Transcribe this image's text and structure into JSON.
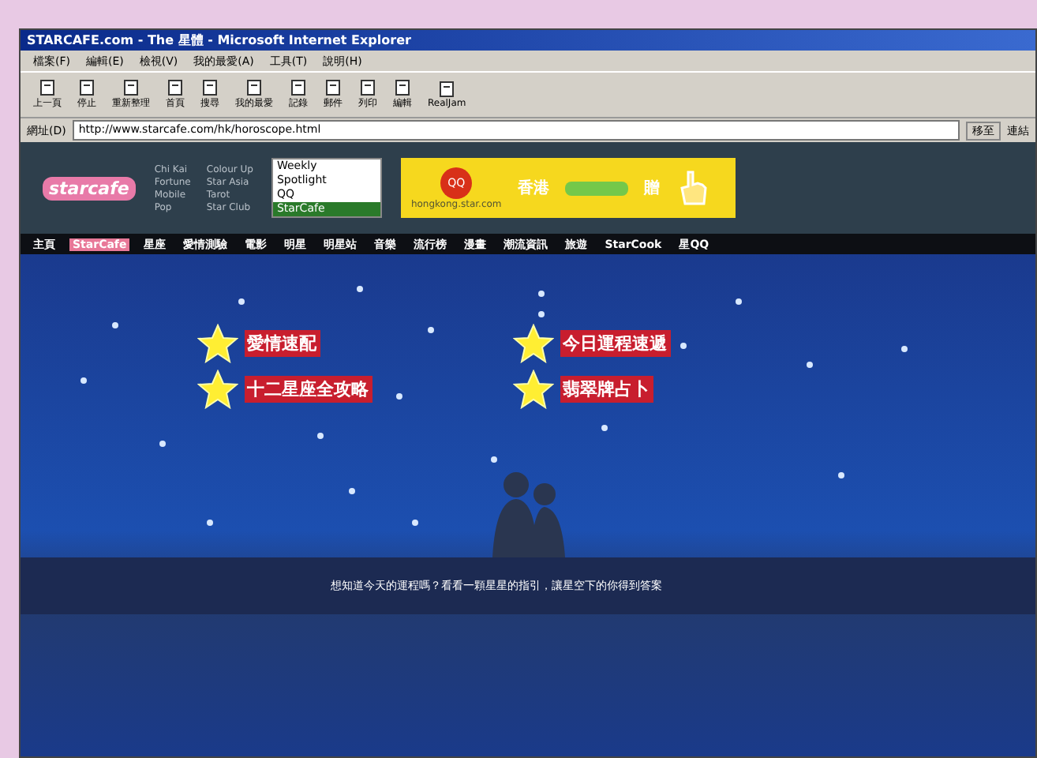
{
  "window": {
    "title": "STARCAFE.com - The 星體 - Microsoft Internet Explorer"
  },
  "menu": [
    "檔案(F)",
    "編輯(E)",
    "檢視(V)",
    "我的最愛(A)",
    "工具(T)",
    "說明(H)"
  ],
  "toolbar": [
    "上一頁",
    "停止",
    "重新整理",
    "首頁",
    "搜尋",
    "我的最愛",
    "記錄",
    "郵件",
    "列印",
    "編輯",
    "RealJam"
  ],
  "address": {
    "label": "網址(D)",
    "value": "http://www.starcafe.com/hk/horoscope.html",
    "go": "移至",
    "links": "連結"
  },
  "site": {
    "logo": "starcafe",
    "links": [
      "Chi Kai",
      "Colour Up",
      "Fortune",
      "Star Asia",
      "Mobile",
      "Tarot",
      "Pop",
      "Star Club"
    ],
    "list": [
      {
        "label": "Weekly",
        "selected": false
      },
      {
        "label": "Spotlight",
        "selected": false
      },
      {
        "label": "QQ",
        "selected": false
      },
      {
        "label": "StarCafe",
        "selected": true
      }
    ],
    "banner": {
      "badge": "QQ",
      "text_1": "香港",
      "text_2": "贈",
      "url": "hongkong.star.com"
    }
  },
  "nav": [
    {
      "label": "主頁",
      "selected": false
    },
    {
      "label": "StarCafe",
      "selected": true
    },
    {
      "label": "星座",
      "selected": false
    },
    {
      "label": "愛情測驗",
      "selected": false
    },
    {
      "label": "電影",
      "selected": false
    },
    {
      "label": "明星",
      "selected": false
    },
    {
      "label": "明星站",
      "selected": false
    },
    {
      "label": "音樂",
      "selected": false
    },
    {
      "label": "流行榜",
      "selected": false
    },
    {
      "label": "漫畫",
      "selected": false
    },
    {
      "label": "潮流資訊",
      "selected": false
    },
    {
      "label": "旅遊",
      "selected": false
    },
    {
      "label": "StarCook",
      "selected": false
    },
    {
      "label": "星QQ",
      "selected": false
    }
  ],
  "star_menu": [
    "愛情速配",
    "今日運程速遞",
    "十二星座全攻略",
    "翡翠牌占卜"
  ],
  "caption": "想知道今天的運程嗎？看看一顆星星的指引，讓星空下的你得到答案"
}
